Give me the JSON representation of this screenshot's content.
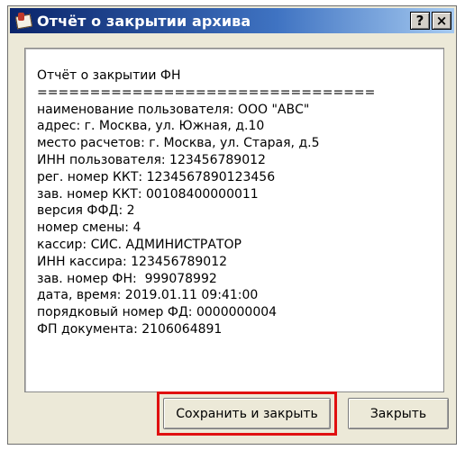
{
  "window": {
    "title": "Отчёт о закрытии архива",
    "help_glyph": "?",
    "close_glyph": "×"
  },
  "report": {
    "lines": [
      "Отчёт о закрытии ФН",
      "================================",
      "наименование пользователя: ООО \"АВС\"",
      "адрес: г. Москва, ул. Южная, д.10",
      "место расчетов: г. Москва, ул. Старая, д.5",
      "ИНН пользователя: 123456789012",
      "рег. номер ККТ: 1234567890123456",
      "зав. номер ККТ: 00108400000011",
      "версия ФФД: 2",
      "номер смены: 4",
      "кассир: СИС. АДМИНИСТРАТОР",
      "ИНН кассира: 123456789012",
      "зав. номер ФН:  999078992",
      "дата, время: 2019.01.11 09:41:00",
      "порядковый номер ФД: 0000000004",
      "ФП документа: 2106064891"
    ]
  },
  "buttons": {
    "save_label": "Сохранить и закрыть",
    "close_label": "Закрыть"
  },
  "highlight_color": "#e01010"
}
